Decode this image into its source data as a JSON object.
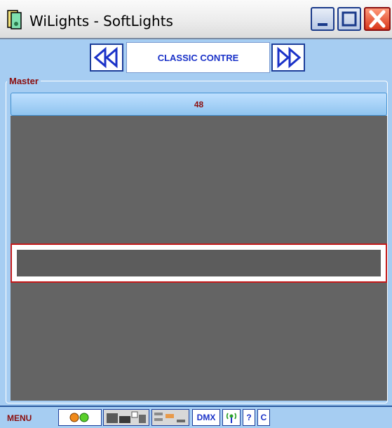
{
  "window": {
    "title": "WiLights - SoftLights",
    "icon": "app-icon"
  },
  "navigation": {
    "prev_icon": "double-left-arrow-icon",
    "next_icon": "double-right-arrow-icon",
    "preset_name": "CLASSIC CONTRE"
  },
  "master": {
    "label": "Master",
    "value": "48",
    "level": 48
  },
  "bottom_bar": {
    "menu_label": "MENU",
    "buttons": [
      {
        "name": "color-dots-icon"
      },
      {
        "name": "layout-view-icon"
      },
      {
        "name": "bars-view-icon"
      },
      {
        "name": "dmx-button",
        "label": "DMX"
      },
      {
        "name": "wireless-icon"
      },
      {
        "name": "help-button",
        "label": "?"
      },
      {
        "name": "c-button",
        "label": "C"
      }
    ]
  },
  "colors": {
    "frame_blue": "#a6cdf2",
    "nav_border": "#1d3e9a",
    "label_red": "#8b0e0e",
    "accent_blue_text": "#1a32c8",
    "fader_border": "#c41a1a"
  }
}
